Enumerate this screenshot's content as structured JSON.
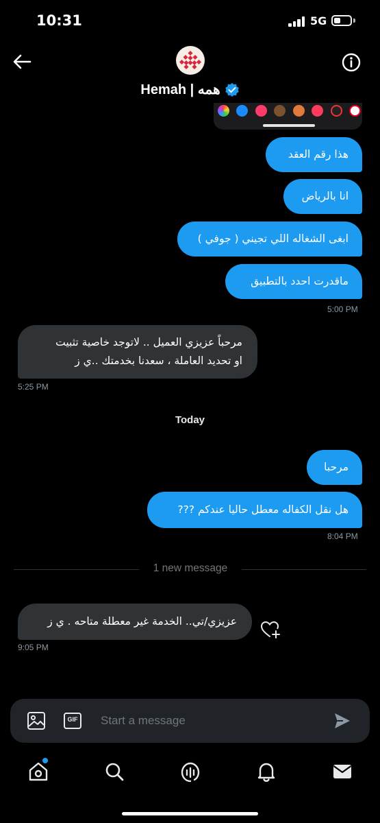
{
  "status_bar": {
    "time": "10:31",
    "network": "5G"
  },
  "header": {
    "title": "Hemah | همه",
    "back_icon": "arrow-left-icon",
    "info_icon": "info-icon",
    "verified_icon": "verified-badge-icon"
  },
  "conversation": {
    "messages": [
      {
        "text": "هذا رقم العقد",
        "direction": "sent"
      },
      {
        "text": "انا بالرياض",
        "direction": "sent"
      },
      {
        "text": "ابغى الشغاله اللي تجيني ( جوفي )",
        "direction": "sent"
      },
      {
        "text": "ماقدرت احدد بالتطبيق",
        "direction": "sent"
      },
      {
        "lines": [
          "مرحباً عزيزي العميل .. لاتوجد خاصية تثبيت",
          "او تحديد العاملة ، سعدنا بخدمتك ..ي ز"
        ],
        "direction": "received"
      },
      {
        "text": "مرحبا",
        "direction": "sent"
      },
      {
        "text": "هل نقل الكفاله معطل حاليا عندكم ???",
        "direction": "sent"
      },
      {
        "text": "عزيزي/تي.. الخدمة غير معطلة متاحه . ي ز",
        "direction": "received"
      }
    ],
    "timestamps": [
      "5:00 PM",
      "5:25 PM",
      "8:04 PM",
      "9:05 PM"
    ],
    "day_separator": "Today",
    "new_message_divider": "1 new message"
  },
  "composer": {
    "placeholder": "Start a message",
    "gif_label": "GIF"
  },
  "colors": {
    "sent_bubble": "#1d9bf0",
    "received_bubble": "#2f3336",
    "background": "#000000",
    "accent": "#1d9bf0"
  },
  "bottom_nav": {
    "items": [
      "home-icon",
      "search-icon",
      "spaces-icon",
      "notifications-icon",
      "messages-icon"
    ]
  }
}
